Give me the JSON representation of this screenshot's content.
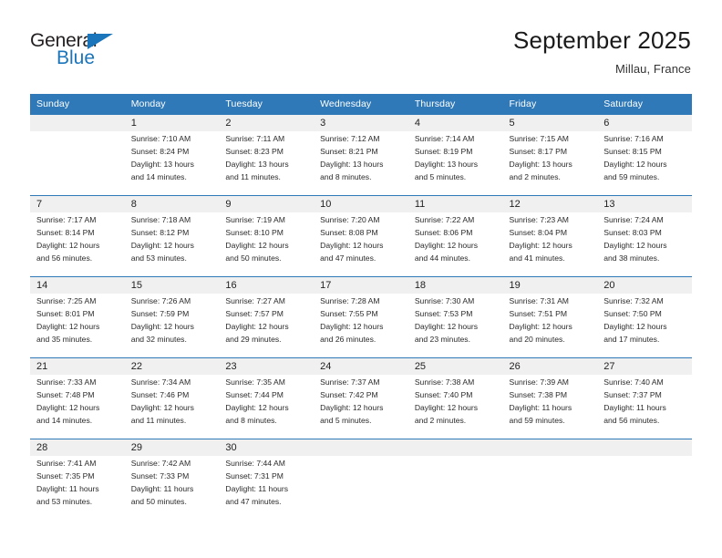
{
  "brand": {
    "name_part1": "General",
    "name_part2": "Blue",
    "accent_color": "#1b75bb"
  },
  "header": {
    "title": "September 2025",
    "location": "Millau, France",
    "header_bg_color": "#3079b8",
    "daynum_bg_color": "#f0f0f0"
  },
  "weekdays": [
    "Sunday",
    "Monday",
    "Tuesday",
    "Wednesday",
    "Thursday",
    "Friday",
    "Saturday"
  ],
  "weeks": [
    [
      {
        "day": "",
        "sunrise": "",
        "sunset": "",
        "daylight_line1": "",
        "daylight_line2": ""
      },
      {
        "day": "1",
        "sunrise": "Sunrise: 7:10 AM",
        "sunset": "Sunset: 8:24 PM",
        "daylight_line1": "Daylight: 13 hours",
        "daylight_line2": "and 14 minutes."
      },
      {
        "day": "2",
        "sunrise": "Sunrise: 7:11 AM",
        "sunset": "Sunset: 8:23 PM",
        "daylight_line1": "Daylight: 13 hours",
        "daylight_line2": "and 11 minutes."
      },
      {
        "day": "3",
        "sunrise": "Sunrise: 7:12 AM",
        "sunset": "Sunset: 8:21 PM",
        "daylight_line1": "Daylight: 13 hours",
        "daylight_line2": "and 8 minutes."
      },
      {
        "day": "4",
        "sunrise": "Sunrise: 7:14 AM",
        "sunset": "Sunset: 8:19 PM",
        "daylight_line1": "Daylight: 13 hours",
        "daylight_line2": "and 5 minutes."
      },
      {
        "day": "5",
        "sunrise": "Sunrise: 7:15 AM",
        "sunset": "Sunset: 8:17 PM",
        "daylight_line1": "Daylight: 13 hours",
        "daylight_line2": "and 2 minutes."
      },
      {
        "day": "6",
        "sunrise": "Sunrise: 7:16 AM",
        "sunset": "Sunset: 8:15 PM",
        "daylight_line1": "Daylight: 12 hours",
        "daylight_line2": "and 59 minutes."
      }
    ],
    [
      {
        "day": "7",
        "sunrise": "Sunrise: 7:17 AM",
        "sunset": "Sunset: 8:14 PM",
        "daylight_line1": "Daylight: 12 hours",
        "daylight_line2": "and 56 minutes."
      },
      {
        "day": "8",
        "sunrise": "Sunrise: 7:18 AM",
        "sunset": "Sunset: 8:12 PM",
        "daylight_line1": "Daylight: 12 hours",
        "daylight_line2": "and 53 minutes."
      },
      {
        "day": "9",
        "sunrise": "Sunrise: 7:19 AM",
        "sunset": "Sunset: 8:10 PM",
        "daylight_line1": "Daylight: 12 hours",
        "daylight_line2": "and 50 minutes."
      },
      {
        "day": "10",
        "sunrise": "Sunrise: 7:20 AM",
        "sunset": "Sunset: 8:08 PM",
        "daylight_line1": "Daylight: 12 hours",
        "daylight_line2": "and 47 minutes."
      },
      {
        "day": "11",
        "sunrise": "Sunrise: 7:22 AM",
        "sunset": "Sunset: 8:06 PM",
        "daylight_line1": "Daylight: 12 hours",
        "daylight_line2": "and 44 minutes."
      },
      {
        "day": "12",
        "sunrise": "Sunrise: 7:23 AM",
        "sunset": "Sunset: 8:04 PM",
        "daylight_line1": "Daylight: 12 hours",
        "daylight_line2": "and 41 minutes."
      },
      {
        "day": "13",
        "sunrise": "Sunrise: 7:24 AM",
        "sunset": "Sunset: 8:03 PM",
        "daylight_line1": "Daylight: 12 hours",
        "daylight_line2": "and 38 minutes."
      }
    ],
    [
      {
        "day": "14",
        "sunrise": "Sunrise: 7:25 AM",
        "sunset": "Sunset: 8:01 PM",
        "daylight_line1": "Daylight: 12 hours",
        "daylight_line2": "and 35 minutes."
      },
      {
        "day": "15",
        "sunrise": "Sunrise: 7:26 AM",
        "sunset": "Sunset: 7:59 PM",
        "daylight_line1": "Daylight: 12 hours",
        "daylight_line2": "and 32 minutes."
      },
      {
        "day": "16",
        "sunrise": "Sunrise: 7:27 AM",
        "sunset": "Sunset: 7:57 PM",
        "daylight_line1": "Daylight: 12 hours",
        "daylight_line2": "and 29 minutes."
      },
      {
        "day": "17",
        "sunrise": "Sunrise: 7:28 AM",
        "sunset": "Sunset: 7:55 PM",
        "daylight_line1": "Daylight: 12 hours",
        "daylight_line2": "and 26 minutes."
      },
      {
        "day": "18",
        "sunrise": "Sunrise: 7:30 AM",
        "sunset": "Sunset: 7:53 PM",
        "daylight_line1": "Daylight: 12 hours",
        "daylight_line2": "and 23 minutes."
      },
      {
        "day": "19",
        "sunrise": "Sunrise: 7:31 AM",
        "sunset": "Sunset: 7:51 PM",
        "daylight_line1": "Daylight: 12 hours",
        "daylight_line2": "and 20 minutes."
      },
      {
        "day": "20",
        "sunrise": "Sunrise: 7:32 AM",
        "sunset": "Sunset: 7:50 PM",
        "daylight_line1": "Daylight: 12 hours",
        "daylight_line2": "and 17 minutes."
      }
    ],
    [
      {
        "day": "21",
        "sunrise": "Sunrise: 7:33 AM",
        "sunset": "Sunset: 7:48 PM",
        "daylight_line1": "Daylight: 12 hours",
        "daylight_line2": "and 14 minutes."
      },
      {
        "day": "22",
        "sunrise": "Sunrise: 7:34 AM",
        "sunset": "Sunset: 7:46 PM",
        "daylight_line1": "Daylight: 12 hours",
        "daylight_line2": "and 11 minutes."
      },
      {
        "day": "23",
        "sunrise": "Sunrise: 7:35 AM",
        "sunset": "Sunset: 7:44 PM",
        "daylight_line1": "Daylight: 12 hours",
        "daylight_line2": "and 8 minutes."
      },
      {
        "day": "24",
        "sunrise": "Sunrise: 7:37 AM",
        "sunset": "Sunset: 7:42 PM",
        "daylight_line1": "Daylight: 12 hours",
        "daylight_line2": "and 5 minutes."
      },
      {
        "day": "25",
        "sunrise": "Sunrise: 7:38 AM",
        "sunset": "Sunset: 7:40 PM",
        "daylight_line1": "Daylight: 12 hours",
        "daylight_line2": "and 2 minutes."
      },
      {
        "day": "26",
        "sunrise": "Sunrise: 7:39 AM",
        "sunset": "Sunset: 7:38 PM",
        "daylight_line1": "Daylight: 11 hours",
        "daylight_line2": "and 59 minutes."
      },
      {
        "day": "27",
        "sunrise": "Sunrise: 7:40 AM",
        "sunset": "Sunset: 7:37 PM",
        "daylight_line1": "Daylight: 11 hours",
        "daylight_line2": "and 56 minutes."
      }
    ],
    [
      {
        "day": "28",
        "sunrise": "Sunrise: 7:41 AM",
        "sunset": "Sunset: 7:35 PM",
        "daylight_line1": "Daylight: 11 hours",
        "daylight_line2": "and 53 minutes."
      },
      {
        "day": "29",
        "sunrise": "Sunrise: 7:42 AM",
        "sunset": "Sunset: 7:33 PM",
        "daylight_line1": "Daylight: 11 hours",
        "daylight_line2": "and 50 minutes."
      },
      {
        "day": "30",
        "sunrise": "Sunrise: 7:44 AM",
        "sunset": "Sunset: 7:31 PM",
        "daylight_line1": "Daylight: 11 hours",
        "daylight_line2": "and 47 minutes."
      },
      {
        "day": "",
        "sunrise": "",
        "sunset": "",
        "daylight_line1": "",
        "daylight_line2": ""
      },
      {
        "day": "",
        "sunrise": "",
        "sunset": "",
        "daylight_line1": "",
        "daylight_line2": ""
      },
      {
        "day": "",
        "sunrise": "",
        "sunset": "",
        "daylight_line1": "",
        "daylight_line2": ""
      },
      {
        "day": "",
        "sunrise": "",
        "sunset": "",
        "daylight_line1": "",
        "daylight_line2": ""
      }
    ]
  ]
}
